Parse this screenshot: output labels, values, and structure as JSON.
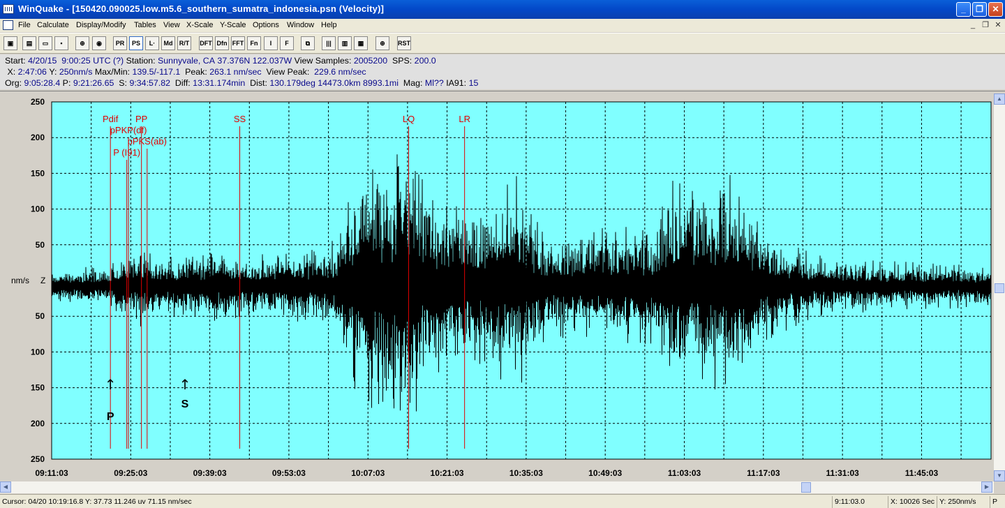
{
  "window": {
    "title": "WinQuake - [150420.090025.low.m5.6_southern_sumatra_indonesia.psn (Velocity)]",
    "minimize_glyph": "_",
    "maximize_glyph": "❐",
    "close_glyph": "✕"
  },
  "menu": {
    "items": [
      "File",
      "Calculate",
      "Display/Modify",
      "Tables",
      "View",
      "X-Scale",
      "Y-Scale",
      "Options",
      "Window",
      "Help"
    ],
    "mdi_minimize": "_",
    "mdi_restore": "❐",
    "mdi_close": "✕"
  },
  "toolbar": {
    "buttons": [
      {
        "id": "open",
        "glyph": "▣"
      },
      {
        "id": "list",
        "glyph": "▤"
      },
      {
        "id": "print",
        "glyph": "▭"
      },
      {
        "id": "save",
        "glyph": "▪"
      },
      {
        "id": "zoom-in",
        "glyph": "⊕"
      },
      {
        "id": "record",
        "glyph": "◉"
      },
      {
        "id": "pr",
        "glyph": "PR"
      },
      {
        "id": "ps",
        "glyph": "PS"
      },
      {
        "id": "ls",
        "glyph": "L·"
      },
      {
        "id": "md",
        "glyph": "Md"
      },
      {
        "id": "rt",
        "glyph": "R/T"
      },
      {
        "id": "dft",
        "glyph": "DFT"
      },
      {
        "id": "dfn",
        "glyph": "Dfn"
      },
      {
        "id": "fft",
        "glyph": "FFT"
      },
      {
        "id": "fn",
        "glyph": "Fn"
      },
      {
        "id": "integrate",
        "glyph": "I"
      },
      {
        "id": "filter",
        "glyph": "F"
      },
      {
        "id": "copy",
        "glyph": "⧉"
      },
      {
        "id": "bars1",
        "glyph": "|||"
      },
      {
        "id": "bars2",
        "glyph": "▥"
      },
      {
        "id": "bars3",
        "glyph": "▦"
      },
      {
        "id": "locate",
        "glyph": "⊕"
      },
      {
        "id": "rst",
        "glyph": "RST"
      }
    ]
  },
  "info": {
    "line1": [
      {
        "k": "Start: ",
        "v": "4/20/15  9:00:25 UTC (?)"
      },
      {
        "k": " Station: ",
        "v": "Sunnyvale, CA 37.376N 122.037W"
      },
      {
        "k": " View Samples: ",
        "v": "2005200"
      },
      {
        "k": "  SPS: ",
        "v": "200.0"
      }
    ],
    "line2": [
      {
        "k": " X: ",
        "v": "2:47:06"
      },
      {
        "k": " Y: ",
        "v": "250nm/s"
      },
      {
        "k": " Max/Min: ",
        "v": "139.5/-117.1"
      },
      {
        "k": "  Peak: ",
        "v": "263.1 nm/sec"
      },
      {
        "k": "  View Peak: ",
        "v": " 229.6 nm/sec"
      }
    ],
    "line3": [
      {
        "k": "Org: ",
        "v": "9:05:28.4"
      },
      {
        "k": " P: ",
        "v": "9:21:26.65"
      },
      {
        "k": "  S: ",
        "v": "9:34:57.82"
      },
      {
        "k": "  Diff: ",
        "v": "13:31.174min"
      },
      {
        "k": "  Dist: ",
        "v": "130.179deg 14473.0km 8993.1mi"
      },
      {
        "k": "  Mag: ",
        "v": "Ml??"
      },
      {
        "k": " IA91: ",
        "v": "15"
      }
    ]
  },
  "plot": {
    "background": "#80ffff",
    "trace_color": "#000000",
    "phase_color": "#e00000",
    "y_unit_label": "nm/s",
    "component_label": "Z",
    "y_ticks": [
      {
        "label": "250",
        "value": 250
      },
      {
        "label": "200",
        "value": 200
      },
      {
        "label": "150",
        "value": 150
      },
      {
        "label": "100",
        "value": 100
      },
      {
        "label": "50",
        "value": 50
      },
      {
        "label": "50",
        "value": -50
      },
      {
        "label": "100",
        "value": -100
      },
      {
        "label": "150",
        "value": -150
      },
      {
        "label": "200",
        "value": -200
      },
      {
        "label": "250",
        "value": -250
      }
    ],
    "x_ticks": [
      {
        "label": "09:11:03",
        "min": 0
      },
      {
        "label": "09:25:03",
        "min": 14
      },
      {
        "label": "09:39:03",
        "min": 28
      },
      {
        "label": "09:53:03",
        "min": 42
      },
      {
        "label": "10:07:03",
        "min": 56
      },
      {
        "label": "10:21:03",
        "min": 70
      },
      {
        "label": "10:35:03",
        "min": 84
      },
      {
        "label": "10:49:03",
        "min": 98
      },
      {
        "label": "11:03:03",
        "min": 112
      },
      {
        "label": "11:17:03",
        "min": 126
      },
      {
        "label": "11:31:03",
        "min": 140
      },
      {
        "label": "11:45:03",
        "min": 154
      }
    ],
    "x_range_min": [
      0,
      166.3
    ],
    "y_range": [
      -250,
      250
    ],
    "phases": [
      {
        "name": "Pdif",
        "min": 10.4,
        "label_row": 0
      },
      {
        "name": "PP",
        "min": 15.9,
        "label_row": 0
      },
      {
        "name": "pPKP(df)",
        "min": 13.6,
        "label_row": 1
      },
      {
        "name": "pPKS(ab)",
        "min": 16.9,
        "label_row": 2
      },
      {
        "name": "P (I91)",
        "min": 13.3,
        "label_row": 3
      },
      {
        "name": "SS",
        "min": 33.3,
        "label_row": 0
      },
      {
        "name": "LQ",
        "min": 63.2,
        "label_row": 0
      },
      {
        "name": "LR",
        "min": 73.1,
        "label_row": 0
      }
    ],
    "picks": [
      {
        "name": "P",
        "min": 10.4,
        "arrow": "↑"
      },
      {
        "name": "S",
        "min": 23.6,
        "arrow": "↑"
      }
    ],
    "envelope": [
      [
        0,
        25
      ],
      [
        10,
        28
      ],
      [
        12,
        45
      ],
      [
        16,
        60
      ],
      [
        20,
        40
      ],
      [
        27,
        55
      ],
      [
        33,
        45
      ],
      [
        40,
        45
      ],
      [
        50,
        65
      ],
      [
        54,
        160
      ],
      [
        57,
        190
      ],
      [
        63,
        215
      ],
      [
        66,
        150
      ],
      [
        72,
        120
      ],
      [
        78,
        115
      ],
      [
        82,
        160
      ],
      [
        88,
        70
      ],
      [
        96,
        80
      ],
      [
        107,
        90
      ],
      [
        110,
        150
      ],
      [
        118,
        150
      ],
      [
        121,
        175
      ],
      [
        126,
        80
      ],
      [
        135,
        45
      ],
      [
        150,
        35
      ],
      [
        166.3,
        30
      ]
    ]
  },
  "scrollbars": {
    "up": "▲",
    "down": "▼",
    "left": "◀",
    "right": "▶"
  },
  "status": {
    "cursor": "Cursor: 04/20 10:19:16.8  Y: 37.73   11.246 uv   71.15 nm/sec",
    "time": "9:11:03.0",
    "x": "X: 10026 Sec",
    "y": "Y: 250nm/s",
    "mode": "P"
  }
}
